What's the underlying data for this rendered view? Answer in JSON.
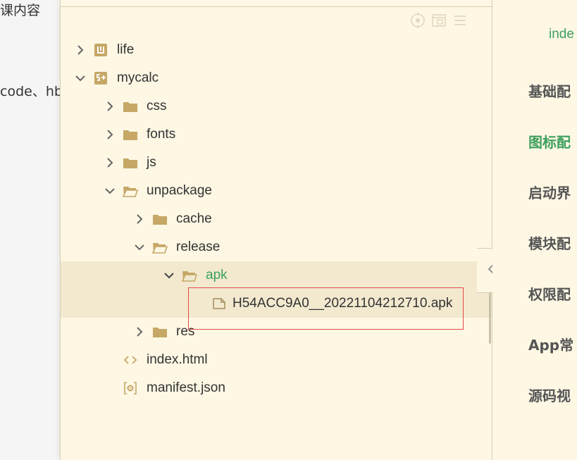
{
  "background_doc": {
    "line1": "课内容",
    "line2": "code、hb"
  },
  "toolbar": {
    "icons": [
      "target-icon",
      "window-icon",
      "menu-icon"
    ]
  },
  "tree": {
    "items": [
      {
        "label": "life"
      },
      {
        "label": "mycalc"
      },
      {
        "label": "css"
      },
      {
        "label": "fonts"
      },
      {
        "label": "js"
      },
      {
        "label": "unpackage"
      },
      {
        "label": "cache"
      },
      {
        "label": "release"
      },
      {
        "label": "apk"
      },
      {
        "label": "H54ACC9A0__20221104212710.apk"
      },
      {
        "label": "res"
      },
      {
        "label": "index.html"
      },
      {
        "label": "manifest.json"
      }
    ]
  },
  "right_panel": {
    "file_tab": "inde",
    "nav": [
      "基础配",
      "图标配",
      "启动界",
      "模块配",
      "权限配",
      "App常",
      "源码视"
    ]
  },
  "colors": {
    "panel_bg": "#fdf7e4",
    "selected_row": "#f2e9cf",
    "folder": "#c6a766",
    "accent_green": "#3ea05e",
    "highlight_red": "#e34a4a"
  }
}
